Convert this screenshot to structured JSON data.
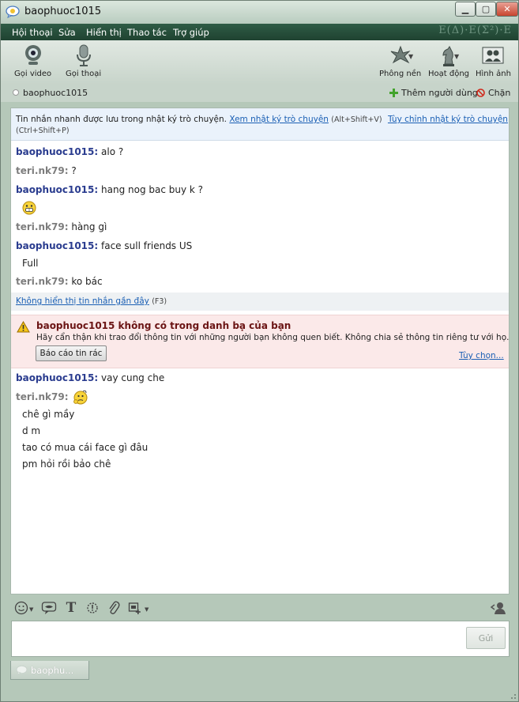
{
  "window": {
    "title": "baophuoc1015"
  },
  "menu": [
    "Hội thoại",
    "Sửa",
    "Hiển thị",
    "Thao tác",
    "Trợ giúp"
  ],
  "menu_decoration": "E(Δ)·E(Σ²)·E",
  "toolbar": {
    "video_call": "Gọi video",
    "voice_call": "Gọi thoại",
    "background": "Phông nền",
    "activities": "Hoạt động",
    "pictures": "Hình ảnh"
  },
  "contact": {
    "name": "baophuoc1015",
    "add_user": "Thêm người dùng",
    "block": "Chặn"
  },
  "info": {
    "text": "Tin nhắn nhanh được lưu trong nhật ký trò chuyện.",
    "view_log": "Xem nhật ký trò chuyện",
    "view_log_shortcut": "(Alt+Shift+V)",
    "customize_log": "Tùy chỉnh nhật ký trò chuyện",
    "customize_shortcut": "(Ctrl+Shift+P)"
  },
  "messages_before": [
    {
      "sender": "baophuoc1015:",
      "text": "alo ?"
    },
    {
      "sender": "teri.nk79:",
      "text": "?"
    },
    {
      "sender": "baophuoc1015:",
      "text": "hang nog bac buy k ?"
    },
    {
      "sender": "teri.nk79:",
      "text": "hàng gì"
    },
    {
      "sender": "baophuoc1015:",
      "text": "face sull friends US"
    },
    {
      "continuation": "Full"
    },
    {
      "sender": "teri.nk79:",
      "text": "ko bác"
    }
  ],
  "hide_recent": {
    "label": "Không hiển thị tin nhắn gần đây",
    "shortcut": "(F3)"
  },
  "warning": {
    "title": "baophuoc1015 không có trong danh bạ của bạn",
    "body": "Hãy cẩn thận khi trao đổi thông tin với những người bạn không quen biết. Không chia sẻ thông tin riêng tư với họ.",
    "report_button": "Báo cáo tin rác",
    "options": "Tùy chọn..."
  },
  "messages_after": [
    {
      "sender": "baophuoc1015:",
      "text": "vay cung che"
    },
    {
      "sender": "teri.nk79:",
      "text": ""
    },
    {
      "continuation": "chê gì mầy"
    },
    {
      "continuation": "d m"
    },
    {
      "continuation": "tao có mua cái face gì đâu"
    },
    {
      "continuation": "pm hỏi rồi bảo chê"
    }
  ],
  "input": {
    "send_button": "Gửi"
  },
  "tab": {
    "label": "baophu..."
  },
  "colors": {
    "menubar": "#1f4231",
    "sender_self": "#2a3c8f",
    "sender_other": "#7d7d7d",
    "warning_bg": "#fbe9e9"
  }
}
